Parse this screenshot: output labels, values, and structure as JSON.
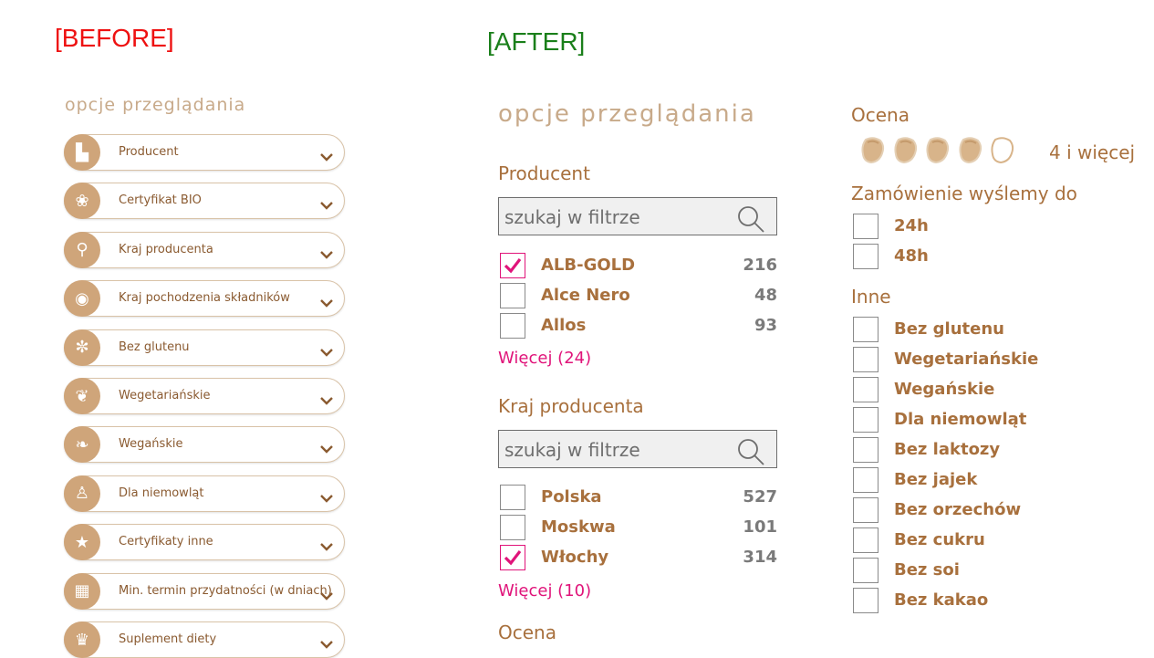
{
  "labels": {
    "before": "[BEFORE]",
    "after": "[AFTER]"
  },
  "before": {
    "title": "opcje przeglądania",
    "filters": [
      {
        "label": "Producent",
        "icon": "factory-icon"
      },
      {
        "label": "Certyfikat BIO",
        "icon": "bio-leaf-icon"
      },
      {
        "label": "Kraj producenta",
        "icon": "map-pin-icon"
      },
      {
        "label": "Kraj pochodzenia składników",
        "icon": "globe-icon"
      },
      {
        "label": "Bez glutenu",
        "icon": "wheat-icon"
      },
      {
        "label": "Wegetariańskie",
        "icon": "leaf-icon"
      },
      {
        "label": "Wegańskie",
        "icon": "vegan-leaf-icon"
      },
      {
        "label": "Dla niemowląt",
        "icon": "baby-bottle-icon"
      },
      {
        "label": "Certyfikaty inne",
        "icon": "star-icon"
      },
      {
        "label": "Min. termin przydatności (w dniach)",
        "icon": "calendar-icon"
      },
      {
        "label": "Suplement diety",
        "icon": "trophy-icon"
      }
    ]
  },
  "after": {
    "title": "opcje przeglądania",
    "producent": {
      "heading": "Producent",
      "search_placeholder": "szukaj w filtrze",
      "items": [
        {
          "label": "ALB-GOLD",
          "count": "216",
          "checked": true
        },
        {
          "label": "Alce Nero",
          "count": "48",
          "checked": false
        },
        {
          "label": "Allos",
          "count": "93",
          "checked": false
        }
      ],
      "more": "Więcej (24)"
    },
    "kraj": {
      "heading": "Kraj producenta",
      "search_placeholder": "szukaj w filtrze",
      "items": [
        {
          "label": "Polska",
          "count": "527",
          "checked": false
        },
        {
          "label": "Moskwa",
          "count": "101",
          "checked": false
        },
        {
          "label": "Włochy",
          "count": "314",
          "checked": true
        }
      ],
      "more": "Więcej (10)"
    },
    "ocena_bottom": "Ocena",
    "ocena": {
      "heading": "Ocena",
      "rating": 4,
      "max": 5,
      "text": "4 i więcej"
    },
    "shipping": {
      "heading": "Zamówienie wyślemy do",
      "items": [
        "24h",
        "48h"
      ]
    },
    "inne": {
      "heading": "Inne",
      "items": [
        "Bez glutenu",
        "Wegetariańskie",
        "Wegańskie",
        "Dla niemowląt",
        "Bez laktozy",
        "Bez jajek",
        "Bez orzechów",
        "Bez cukru",
        "Bez soi",
        "Bez kakao"
      ]
    },
    "colors": {
      "accent": "#a8703d",
      "check": "#e0147a",
      "count": "#7a7a7a"
    }
  }
}
